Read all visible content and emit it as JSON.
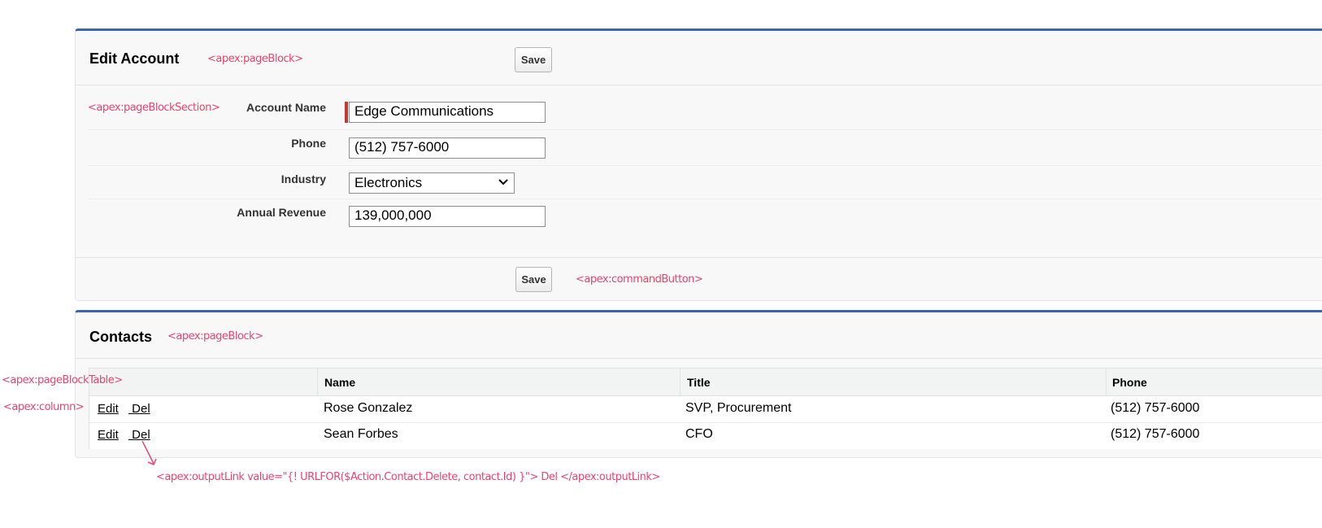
{
  "annotations": {
    "page_block_1": "<apex:pageBlock>",
    "page_block_section": "<apex:pageBlockSection>",
    "command_button": "<apex:commandButton>",
    "page_block_2": "<apex:pageBlock>",
    "page_block_table": "<apex:pageBlockTable>",
    "column": "<apex:column>",
    "output_link": "<apex:outputLink value=\"{! URLFOR($Action.Contact.Delete, contact.Id) }\"> Del </apex:outputLink>"
  },
  "edit_account": {
    "title": "Edit Account",
    "save_top": "Save",
    "save_bottom": "Save",
    "fields": [
      {
        "label": "Account Name",
        "value": "Edge Communications"
      },
      {
        "label": "Phone",
        "value": "(512) 757-6000"
      },
      {
        "label": "Industry",
        "value": "Electronics"
      },
      {
        "label": "Annual Revenue",
        "value": "139,000,000"
      }
    ]
  },
  "contacts": {
    "title": "Contacts",
    "columns": [
      "Name",
      "Title",
      "Phone"
    ],
    "rows": [
      {
        "edit": "Edit",
        "del": " Del",
        "name": "Rose Gonzalez",
        "title": "SVP, Procurement",
        "phone": "(512) 757-6000"
      },
      {
        "edit": "Edit",
        "del": " Del",
        "name": "Sean Forbes",
        "title": "CFO",
        "phone": "(512) 757-6000"
      }
    ]
  },
  "colors": {
    "accent": "#3d63b4",
    "annotation": "#e8456f",
    "required": "#c23934"
  }
}
